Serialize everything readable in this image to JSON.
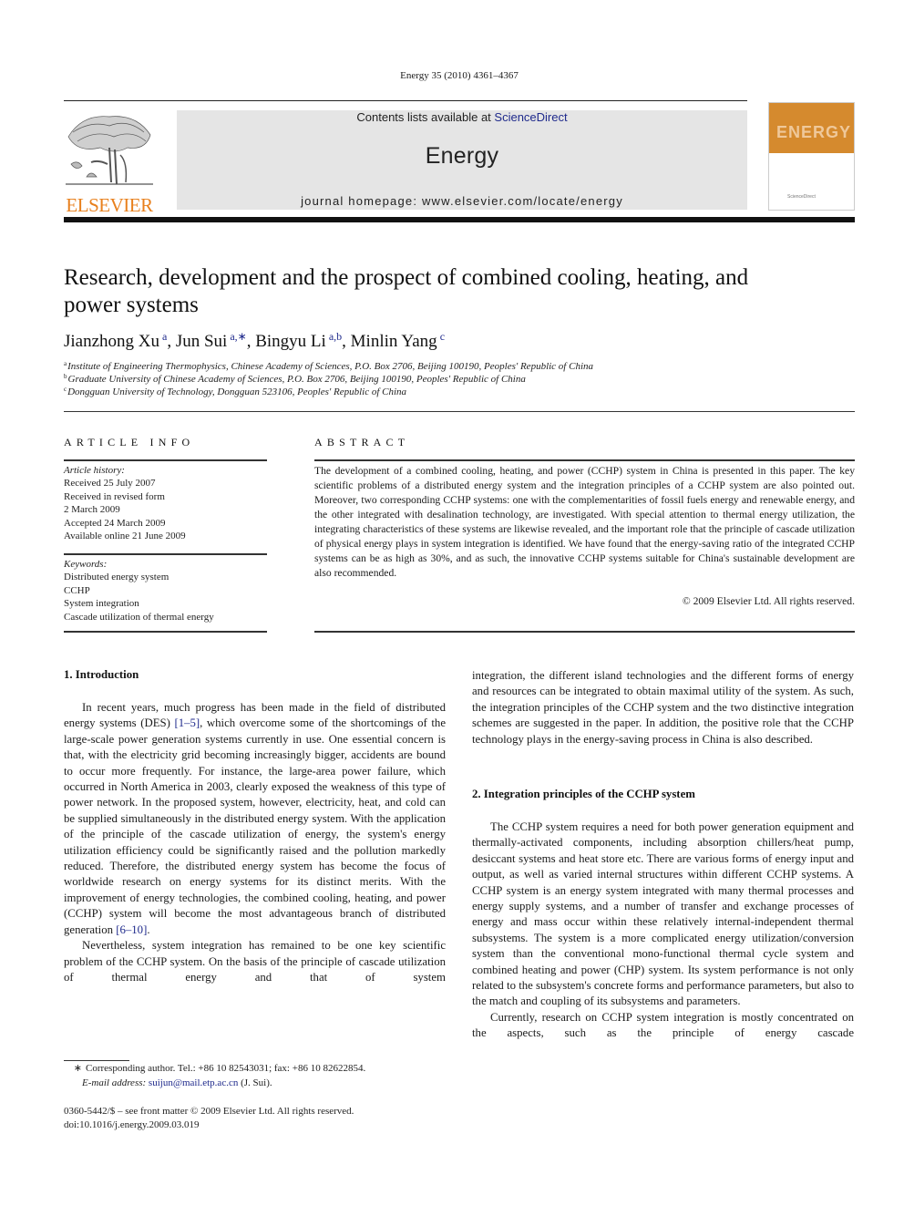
{
  "citation": "Energy 35 (2010) 4361–4367",
  "header": {
    "contents_prefix": "Contents lists available at ",
    "contents_link": "ScienceDirect",
    "journal_name": "Energy",
    "homepage": "journal homepage: www.elsevier.com/locate/energy",
    "publisher_logo_text": "ELSEVIER",
    "cover_title": "ENERGY",
    "cover_subtitle": "ScienceDirect",
    "brand_color": "#e8801d",
    "link_color": "#1f2a8c"
  },
  "article": {
    "title": "Research, development and the prospect of combined cooling, heating, and power systems",
    "authors": [
      {
        "name": "Jianzhong Xu",
        "affil": "a"
      },
      {
        "name": "Jun Sui",
        "affil": "a,∗"
      },
      {
        "name": "Bingyu Li",
        "affil": "a,b"
      },
      {
        "name": "Minlin Yang",
        "affil": "c"
      }
    ],
    "affiliations": [
      {
        "mark": "a",
        "text": "Institute of Engineering Thermophysics, Chinese Academy of Sciences, P.O. Box 2706, Beijing 100190, Peoples' Republic of China"
      },
      {
        "mark": "b",
        "text": "Graduate University of Chinese Academy of Sciences, P.O. Box 2706, Beijing 100190, Peoples' Republic of China"
      },
      {
        "mark": "c",
        "text": "Dongguan University of Technology, Dongguan 523106, Peoples' Republic of China"
      }
    ]
  },
  "article_info": {
    "heading": "ARTICLE INFO",
    "history_label": "Article history:",
    "history": [
      "Received 25 July 2007",
      "Received in revised form",
      "2 March 2009",
      "Accepted 24 March 2009",
      "Available online 21 June 2009"
    ],
    "keywords_label": "Keywords:",
    "keywords": [
      "Distributed energy system",
      "CCHP",
      "System integration",
      "Cascade utilization of thermal energy"
    ]
  },
  "abstract": {
    "heading": "ABSTRACT",
    "body": "The development of a combined cooling, heating, and power (CCHP) system in China is presented in this paper. The key scientific problems of a distributed energy system and the integration principles of a CCHP system are also pointed out. Moreover, two corresponding CCHP systems: one with the complementarities of fossil fuels energy and renewable energy, and the other integrated with desalination technology, are investigated. With special attention to thermal energy utilization, the integrating characteristics of these systems are likewise revealed, and the important role that the principle of cascade utilization of physical energy plays in system integration is identified. We have found that the energy-saving ratio of the integrated CCHP systems can be as high as 30%, and as such, the innovative CCHP systems suitable for China's sustainable development are also recommended.",
    "copyright": "© 2009 Elsevier Ltd. All rights reserved."
  },
  "section1": {
    "heading": "1.  Introduction",
    "p1_a": "In recent years, much progress has been made in the field of distributed energy systems (DES) ",
    "p1_ref1": "[1–5]",
    "p1_b": ", which overcome some of the shortcomings of the large-scale power generation systems currently in use. One essential concern is that, with the electricity grid becoming increasingly bigger, accidents are bound to occur more frequently. For instance, the large-area power failure, which occurred in North America in 2003, clearly exposed the weakness of this type of power network. In the proposed system, however, electricity, heat, and cold can be supplied simultaneously in the distributed energy system. With the application of the principle of the cascade utilization of energy, the system's energy utilization efficiency could be significantly raised and the pollution markedly reduced. Therefore, the distributed energy system has become the focus of worldwide research on energy systems for its distinct merits. With the improvement of energy technologies, the combined cooling, heating, and power (CCHP) system will become the most advantageous branch of distributed generation ",
    "p1_ref2": "[6–10]",
    "p1_c": ".",
    "p2": "Nevertheless, system integration has remained to be one key scientific problem of the CCHP system. On the basis of the principle of cascade utilization of thermal energy and that of system",
    "p2_cont": "integration, the different island technologies and the different forms of energy and resources can be integrated to obtain maximal utility of the system. As such, the integration principles of the CCHP system and the two distinctive integration schemes are suggested in the paper. In addition, the positive role that the CCHP technology plays in the energy-saving process in China is also described."
  },
  "section2": {
    "heading": "2.  Integration principles of the CCHP system",
    "p1": "The CCHP system requires a need for both power generation equipment and thermally-activated components, including absorption chillers/heat pump, desiccant systems and heat store etc. There are various forms of energy input and output, as well as varied internal structures within different CCHP systems. A CCHP system is an energy system integrated with many thermal processes and energy supply systems, and a number of transfer and exchange processes of energy and mass occur within these relatively internal-independent thermal subsystems. The system is a more complicated energy utilization/conversion system than the conventional mono-functional thermal cycle system and combined heating and power (CHP) system. Its system performance is not only related to the subsystem's concrete forms and performance parameters, but also to the match and coupling of its subsystems and parameters.",
    "p2": "Currently, research on CCHP system integration is mostly concentrated on the aspects, such as the principle of energy cascade"
  },
  "footnote": {
    "star": "∗",
    "line1": "Corresponding author. Tel.: +86 10 82543031; fax: +86 10 82622854.",
    "email_label": "E-mail address: ",
    "email": "suijun@mail.etp.ac.cn",
    "email_suffix": " (J. Sui)."
  },
  "front_matter": {
    "issn": "0360-5442/$ – see front matter © 2009 Elsevier Ltd. All rights reserved.",
    "doi": "doi:10.1016/j.energy.2009.03.019"
  }
}
